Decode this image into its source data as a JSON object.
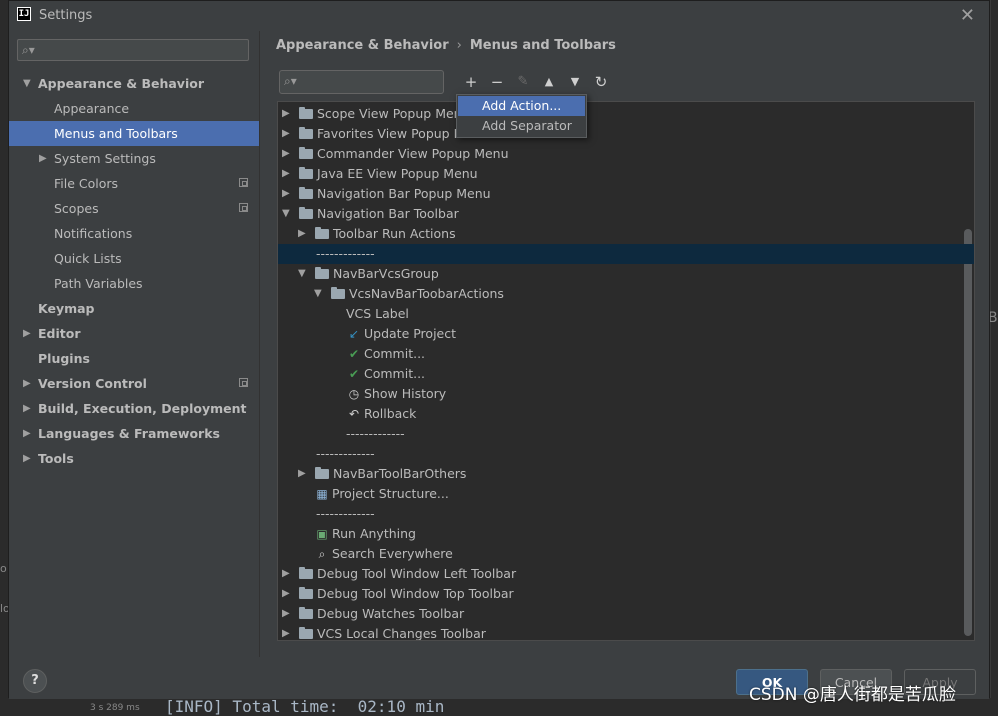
{
  "window": {
    "title": "Settings",
    "app_logo": "IJ"
  },
  "sidebar": {
    "search_placeholder": "",
    "items": [
      {
        "label": "Appearance & Behavior",
        "level": 0,
        "arrow": "▼",
        "bold": true
      },
      {
        "label": "Appearance",
        "level": 1
      },
      {
        "label": "Menus and Toolbars",
        "level": 1,
        "selected": true
      },
      {
        "label": "System Settings",
        "level": 1,
        "arrow": "▶"
      },
      {
        "label": "File Colors",
        "level": 1,
        "badge": true
      },
      {
        "label": "Scopes",
        "level": 1,
        "badge": true
      },
      {
        "label": "Notifications",
        "level": 1
      },
      {
        "label": "Quick Lists",
        "level": 1
      },
      {
        "label": "Path Variables",
        "level": 1
      },
      {
        "label": "Keymap",
        "level": 0,
        "bold": true
      },
      {
        "label": "Editor",
        "level": 0,
        "arrow": "▶",
        "bold": true
      },
      {
        "label": "Plugins",
        "level": 0,
        "bold": true
      },
      {
        "label": "Version Control",
        "level": 0,
        "arrow": "▶",
        "bold": true,
        "badge": true
      },
      {
        "label": "Build, Execution, Deployment",
        "level": 0,
        "arrow": "▶",
        "bold": true
      },
      {
        "label": "Languages & Frameworks",
        "level": 0,
        "arrow": "▶",
        "bold": true
      },
      {
        "label": "Tools",
        "level": 0,
        "arrow": "▶",
        "bold": true
      }
    ]
  },
  "breadcrumb": {
    "parent": "Appearance & Behavior",
    "separator": "›",
    "current": "Menus and Toolbars"
  },
  "toolbar": {
    "search_placeholder": "",
    "add": "+",
    "remove": "−",
    "edit": "✎",
    "move_up": "▲",
    "move_down": "▼",
    "restore": "↻"
  },
  "popup": {
    "items": [
      "Add Action...",
      "Add Separator"
    ]
  },
  "tree": [
    {
      "label": "Scope View Popup Menu",
      "level": 0,
      "arrow": "▶",
      "icon": "folder"
    },
    {
      "label": "Favorites View Popup Menu",
      "level": 0,
      "arrow": "▶",
      "icon": "folder"
    },
    {
      "label": "Commander View Popup Menu",
      "level": 0,
      "arrow": "▶",
      "icon": "folder"
    },
    {
      "label": "Java EE View Popup Menu",
      "level": 0,
      "arrow": "▶",
      "icon": "folder"
    },
    {
      "label": "Navigation Bar Popup Menu",
      "level": 0,
      "arrow": "▶",
      "icon": "folder"
    },
    {
      "label": "Navigation Bar Toolbar",
      "level": 0,
      "arrow": "▼",
      "icon": "folder"
    },
    {
      "label": "Toolbar Run Actions",
      "level": 1,
      "arrow": "▶",
      "icon": "folder"
    },
    {
      "label": "-------------",
      "level": 1,
      "selected": true
    },
    {
      "label": "NavBarVcsGroup",
      "level": 1,
      "arrow": "▼",
      "icon": "folder"
    },
    {
      "label": "VcsNavBarToobarActions",
      "level": 2,
      "arrow": "▼",
      "icon": "folder"
    },
    {
      "label": "VCS Label",
      "level": 3
    },
    {
      "label": "Update Project",
      "level": 3,
      "icon": "update"
    },
    {
      "label": "Commit...",
      "level": 3,
      "icon": "check"
    },
    {
      "label": "Commit...",
      "level": 3,
      "icon": "check"
    },
    {
      "label": "Show History",
      "level": 3,
      "icon": "clock"
    },
    {
      "label": "Rollback",
      "level": 3,
      "icon": "rollback"
    },
    {
      "label": "-------------",
      "level": 3
    },
    {
      "label": "-------------",
      "level": 1
    },
    {
      "label": "NavBarToolBarOthers",
      "level": 1,
      "arrow": "▶",
      "icon": "folder"
    },
    {
      "label": "Project Structure...",
      "level": 1,
      "icon": "structure"
    },
    {
      "label": "-------------",
      "level": 1
    },
    {
      "label": "Run Anything",
      "level": 1,
      "icon": "run"
    },
    {
      "label": "Search Everywhere",
      "level": 1,
      "icon": "search"
    },
    {
      "label": "Debug Tool Window Left Toolbar",
      "level": 0,
      "arrow": "▶",
      "icon": "folder"
    },
    {
      "label": "Debug Tool Window Top Toolbar",
      "level": 0,
      "arrow": "▶",
      "icon": "folder"
    },
    {
      "label": "Debug Watches Toolbar",
      "level": 0,
      "arrow": "▶",
      "icon": "folder"
    },
    {
      "label": "VCS Local Changes Toolbar",
      "level": 0,
      "arrow": "▶",
      "icon": "folder"
    }
  ],
  "footer": {
    "help": "?",
    "ok": "OK",
    "cancel": "Cancel",
    "apply": "Apply"
  },
  "background": {
    "log": "[INFO] Total time:  02:10 min",
    "time": "3 s 289 ms",
    "edge_left_1": "o",
    "edge_left_2": "lo",
    "edge_right": "Bo"
  },
  "watermark": "CSDN @唐人街都是苦瓜脸",
  "colors": {
    "selection": "#4b6eaf",
    "tree_selection": "#0d293e",
    "ok_button": "#365880"
  }
}
